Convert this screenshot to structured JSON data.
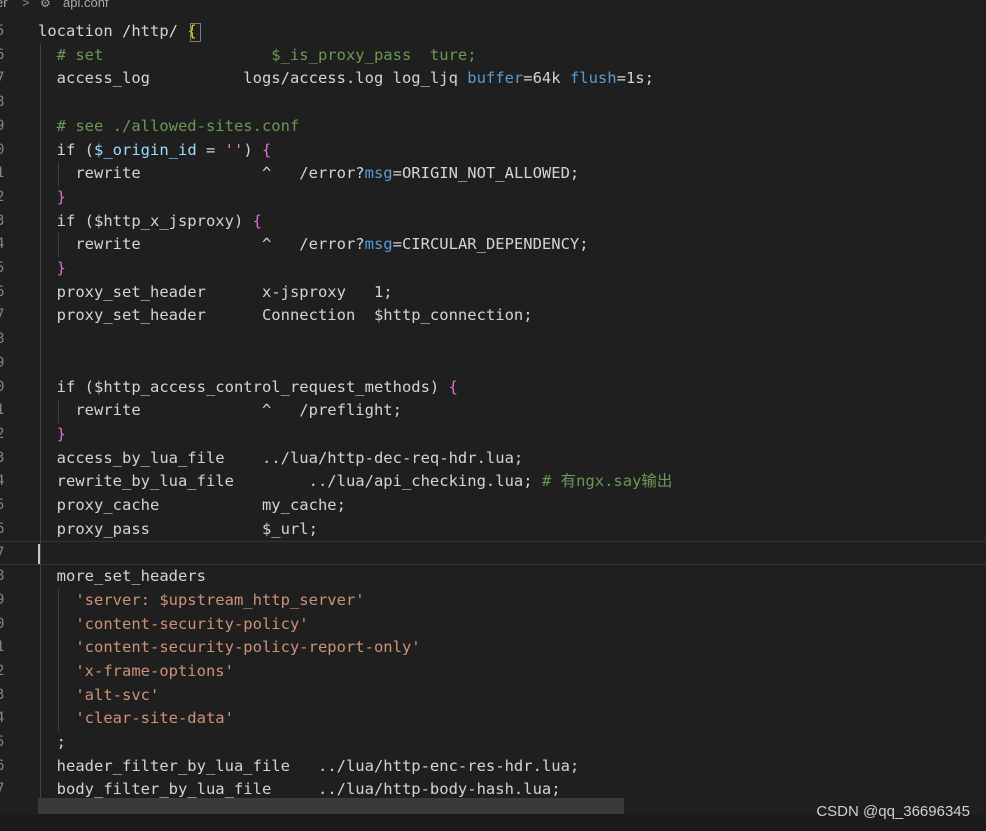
{
  "breadcrumb": {
    "folder": "er",
    "separator": ">",
    "file_icon": "gear-icon",
    "file": "api.conf"
  },
  "colors": {
    "background": "#1f1f1f",
    "comment": "#6a9955",
    "keyword_blue": "#569cd6",
    "string": "#ce9178",
    "brace": "#da70d6",
    "line_number": "#858585"
  },
  "lines": [
    {
      "no": "5",
      "tokens": [
        {
          "c": "plain",
          "t": "location /http/ "
        },
        {
          "c": "brace-yellow",
          "t": "{"
        }
      ]
    },
    {
      "no": "6",
      "tokens": [
        {
          "c": "comment",
          "t": "  # set                  $_is_proxy_pass  ture;"
        }
      ]
    },
    {
      "no": "7",
      "tokens": [
        {
          "c": "plain",
          "t": "  access_log          logs/access.log log_ljq "
        },
        {
          "c": "blue",
          "t": "buffer"
        },
        {
          "c": "op",
          "t": "=64k "
        },
        {
          "c": "blue",
          "t": "flush"
        },
        {
          "c": "op",
          "t": "=1s;"
        }
      ]
    },
    {
      "no": "8",
      "tokens": []
    },
    {
      "no": "9",
      "tokens": [
        {
          "c": "comment",
          "t": "  # see ./allowed-sites.conf"
        }
      ]
    },
    {
      "no": "0",
      "tokens": [
        {
          "c": "plain",
          "t": "  if ("
        },
        {
          "c": "var",
          "t": "$_origin_id"
        },
        {
          "c": "plain",
          "t": " = "
        },
        {
          "c": "string",
          "t": "''"
        },
        {
          "c": "plain",
          "t": ") "
        },
        {
          "c": "brace",
          "t": "{"
        }
      ]
    },
    {
      "no": "1",
      "tokens": [
        {
          "c": "plain",
          "t": "    rewrite             ^   /error?"
        },
        {
          "c": "blue",
          "t": "msg"
        },
        {
          "c": "plain",
          "t": "=ORIGIN_NOT_ALLOWED;"
        }
      ]
    },
    {
      "no": "2",
      "tokens": [
        {
          "c": "brace",
          "t": "  }"
        }
      ]
    },
    {
      "no": "3",
      "tokens": [
        {
          "c": "plain",
          "t": "  if ($http_x_jsproxy) "
        },
        {
          "c": "brace",
          "t": "{"
        }
      ]
    },
    {
      "no": "4",
      "tokens": [
        {
          "c": "plain",
          "t": "    rewrite             ^   /error?"
        },
        {
          "c": "blue",
          "t": "msg"
        },
        {
          "c": "plain",
          "t": "=CIRCULAR_DEPENDENCY;"
        }
      ]
    },
    {
      "no": "5",
      "tokens": [
        {
          "c": "brace",
          "t": "  }"
        }
      ]
    },
    {
      "no": "6",
      "tokens": [
        {
          "c": "plain",
          "t": "  proxy_set_header      x-jsproxy   1;"
        }
      ]
    },
    {
      "no": "7",
      "tokens": [
        {
          "c": "plain",
          "t": "  proxy_set_header      Connection  $http_connection;"
        }
      ]
    },
    {
      "no": "8",
      "tokens": []
    },
    {
      "no": "9",
      "tokens": []
    },
    {
      "no": "0",
      "tokens": [
        {
          "c": "plain",
          "t": "  if ($http_access_control_request_methods) "
        },
        {
          "c": "brace",
          "t": "{"
        }
      ]
    },
    {
      "no": "1",
      "tokens": [
        {
          "c": "plain",
          "t": "    rewrite             ^   /preflight;"
        }
      ]
    },
    {
      "no": "2",
      "tokens": [
        {
          "c": "brace",
          "t": "  }"
        }
      ]
    },
    {
      "no": "3",
      "tokens": [
        {
          "c": "plain",
          "t": "  access_by_lua_file    ../lua/http-dec-req-hdr.lua;"
        }
      ]
    },
    {
      "no": "4",
      "tokens": [
        {
          "c": "plain",
          "t": "  rewrite_by_lua_file        ../lua/api_checking.lua; "
        },
        {
          "c": "comment",
          "t": "# 有ngx.say输出"
        }
      ]
    },
    {
      "no": "5",
      "tokens": [
        {
          "c": "plain",
          "t": "  proxy_cache           my_cache;"
        }
      ]
    },
    {
      "no": "6",
      "tokens": [
        {
          "c": "plain",
          "t": "  proxy_pass            $_url;"
        }
      ]
    },
    {
      "no": "7",
      "tokens": [],
      "current": true
    },
    {
      "no": "8",
      "tokens": [
        {
          "c": "plain",
          "t": "  more_set_headers"
        }
      ]
    },
    {
      "no": "9",
      "tokens": [
        {
          "c": "string",
          "t": "    'server: $upstream_http_server'"
        }
      ]
    },
    {
      "no": "0",
      "tokens": [
        {
          "c": "string",
          "t": "    'content-security-policy'"
        }
      ]
    },
    {
      "no": "1",
      "tokens": [
        {
          "c": "string",
          "t": "    'content-security-policy-report-only'"
        }
      ]
    },
    {
      "no": "2",
      "tokens": [
        {
          "c": "string",
          "t": "    'x-frame-options'"
        }
      ]
    },
    {
      "no": "3",
      "tokens": [
        {
          "c": "string",
          "t": "    'alt-svc'"
        }
      ]
    },
    {
      "no": "4",
      "tokens": [
        {
          "c": "string",
          "t": "    'clear-site-data'"
        }
      ]
    },
    {
      "no": "5",
      "tokens": [
        {
          "c": "plain",
          "t": "  ;"
        }
      ]
    },
    {
      "no": "6",
      "tokens": [
        {
          "c": "plain",
          "t": "  header_filter_by_lua_file   ../lua/http-enc-res-hdr.lua;"
        }
      ]
    },
    {
      "no": "7",
      "tokens": [
        {
          "c": "plain",
          "t": "  body_filter_by_lua_file     ../lua/http-body-hash.lua;"
        }
      ]
    }
  ],
  "watermark": "CSDN @qq_36696345"
}
